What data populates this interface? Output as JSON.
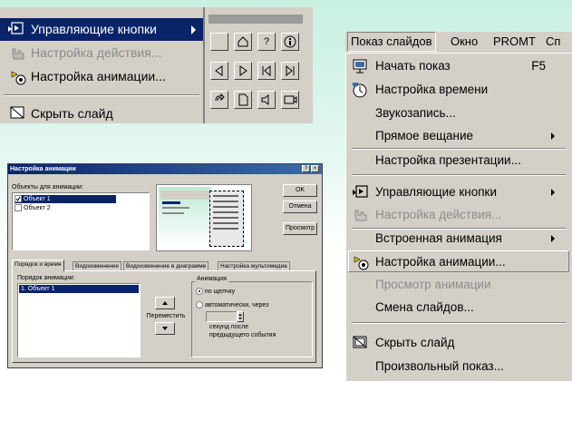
{
  "submenu_crop": {
    "items": [
      {
        "label": "Управляющие кнопки",
        "state": "highlighted",
        "icon": "action-buttons-icon"
      },
      {
        "label": "Настройка действия...",
        "state": "disabled",
        "icon": "hand-action-icon"
      },
      {
        "label": "Настройка анимации...",
        "state": "normal",
        "icon": "animation-icon"
      },
      {
        "label": "Скрыть слайд",
        "state": "normal",
        "icon": "hide-slide-icon"
      }
    ],
    "action_buttons": [
      "blank",
      "home",
      "help",
      "info",
      "back",
      "forward",
      "beginning",
      "end",
      "return",
      "document",
      "sound",
      "movie"
    ]
  },
  "dialog": {
    "title": "Настройка анимации",
    "title_buttons": {
      "help": "?",
      "close": "×"
    },
    "objects_label": "Объекты для анимации:",
    "objects": [
      {
        "label": "Объект 1",
        "checked": true,
        "selected": true
      },
      {
        "label": "Объект 2",
        "checked": false,
        "selected": false
      }
    ],
    "buttons": {
      "ok": "OK",
      "cancel": "Отмена",
      "preview": "Просмотр"
    },
    "tabs": [
      "Порядок и время",
      "Видоизменение",
      "Видоизменение в диаграмме",
      "Настройка мультимедиа"
    ],
    "active_tab": "Порядок и время",
    "order_label": "Порядок анимации:",
    "order_items": [
      "1. Объект 1"
    ],
    "move_label": "Переместить",
    "animation_group": "Анимация",
    "on_click": "по щелчку",
    "auto": "автоматически, через",
    "seconds_after": "секунд после",
    "previous_event": "предыдущего события"
  },
  "right_menu": {
    "menubar": [
      "Показ слайдов",
      "Окно",
      "PROMT",
      "Сп"
    ],
    "items": [
      {
        "label": "Начать показ",
        "shortcut": "F5",
        "icon": "start-show-icon",
        "state": "normal"
      },
      {
        "label": "Настройка времени",
        "icon": "rehearse-timing-icon",
        "state": "normal"
      },
      {
        "label": "Звукозапись...",
        "state": "normal"
      },
      {
        "label": "Прямое вещание",
        "submenu": true,
        "state": "normal"
      },
      {
        "label": "Настройка презентации...",
        "state": "normal"
      },
      {
        "label": "Управляющие кнопки",
        "submenu": true,
        "icon": "action-buttons-icon",
        "state": "normal"
      },
      {
        "label": "Настройка действия...",
        "icon": "hand-action-icon",
        "state": "disabled"
      },
      {
        "label": "Встроенная анимация",
        "submenu": true,
        "state": "normal"
      },
      {
        "label": "Настройка анимации...",
        "icon": "animation-icon",
        "state": "highlighted"
      },
      {
        "label": "Просмотр анимации",
        "state": "disabled"
      },
      {
        "label": "Смена слайдов...",
        "state": "normal"
      },
      {
        "label": "Скрыть слайд",
        "icon": "hide-slide-icon",
        "state": "normal"
      },
      {
        "label": "Произвольный показ...",
        "state": "normal"
      }
    ]
  }
}
